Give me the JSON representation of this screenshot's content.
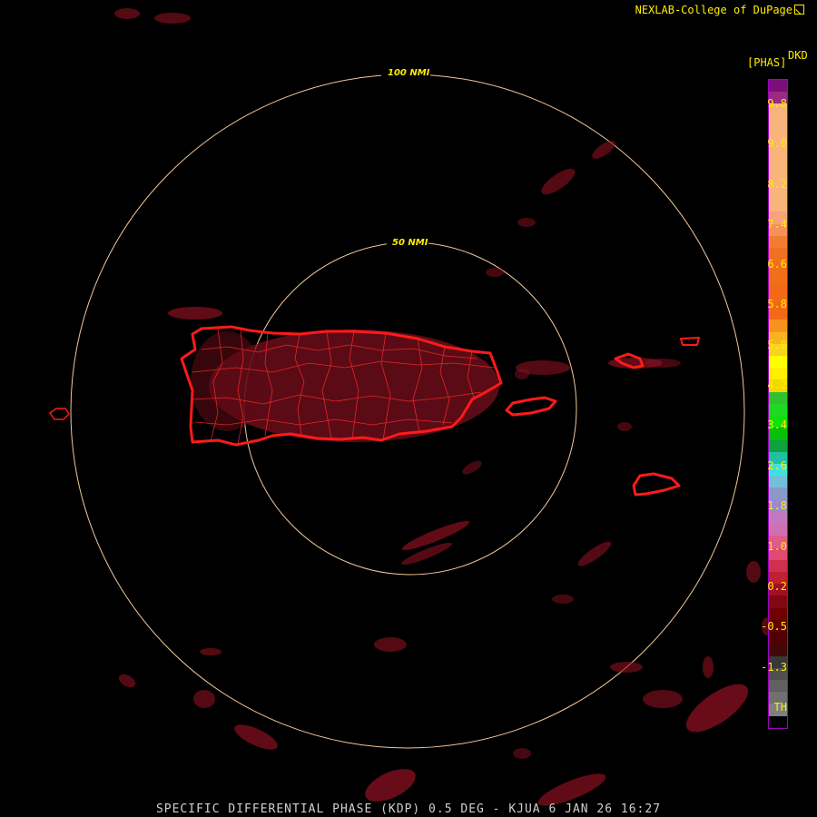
{
  "header": {
    "credit": "NEXLAB-College of DuPage",
    "product_code": "DKD",
    "units": "[PHAS]"
  },
  "rings": [
    {
      "label": "100 NMI",
      "range_nmi": 100
    },
    {
      "label": "50 NMI",
      "range_nmi": 50
    }
  ],
  "footer": {
    "caption": "SPECIFIC DIFFERENTIAL PHASE (KDP) 0.5 DEG - KJUA 6 JAN 26 16:27"
  },
  "legend": {
    "labels": [
      "9.8",
      "9.0",
      "8.2",
      "7.4",
      "6.6",
      "5.8",
      "5.0",
      "4.2",
      "3.4",
      "2.6",
      "1.8",
      "1.0",
      "0.2",
      "-0.5",
      "-1.3",
      "TH"
    ],
    "colors": [
      "#7a0f7c",
      "#9a2a82",
      "#f7b37d",
      "#f8b47a",
      "#f8b47a",
      "#f8b47a",
      "#f8b47a",
      "#f8b47a",
      "#f8b47a",
      "#f8b47a",
      "#f8b47a",
      "#f7a27a",
      "#f5905a",
      "#f37c33",
      "#f07020",
      "#f26f1a",
      "#f26f1a",
      "#f26a18",
      "#f26a18",
      "#f26a18",
      "#f8921e",
      "#f8b41e",
      "#f8d41e",
      "#ffff00",
      "#ffee00",
      "#f0d800",
      "#30c030",
      "#20d820",
      "#10e010",
      "#08c008",
      "#10a040",
      "#20c0a0",
      "#40e0e0",
      "#70c0d8",
      "#8a98c8",
      "#9a8ad0",
      "#c07ac0",
      "#d070b0",
      "#e05a8a",
      "#e04a70",
      "#d03050",
      "#c02030",
      "#a01020",
      "#800810",
      "#700000",
      "#600000",
      "#500000",
      "#400808",
      "#383838",
      "#505050",
      "#606060",
      "#707070",
      "#808080",
      "#000000"
    ]
  },
  "colors": {
    "outline": "#ff1a1a",
    "echo": "#8a1020",
    "ring": "#f2c79a",
    "text": "#ffee00"
  }
}
